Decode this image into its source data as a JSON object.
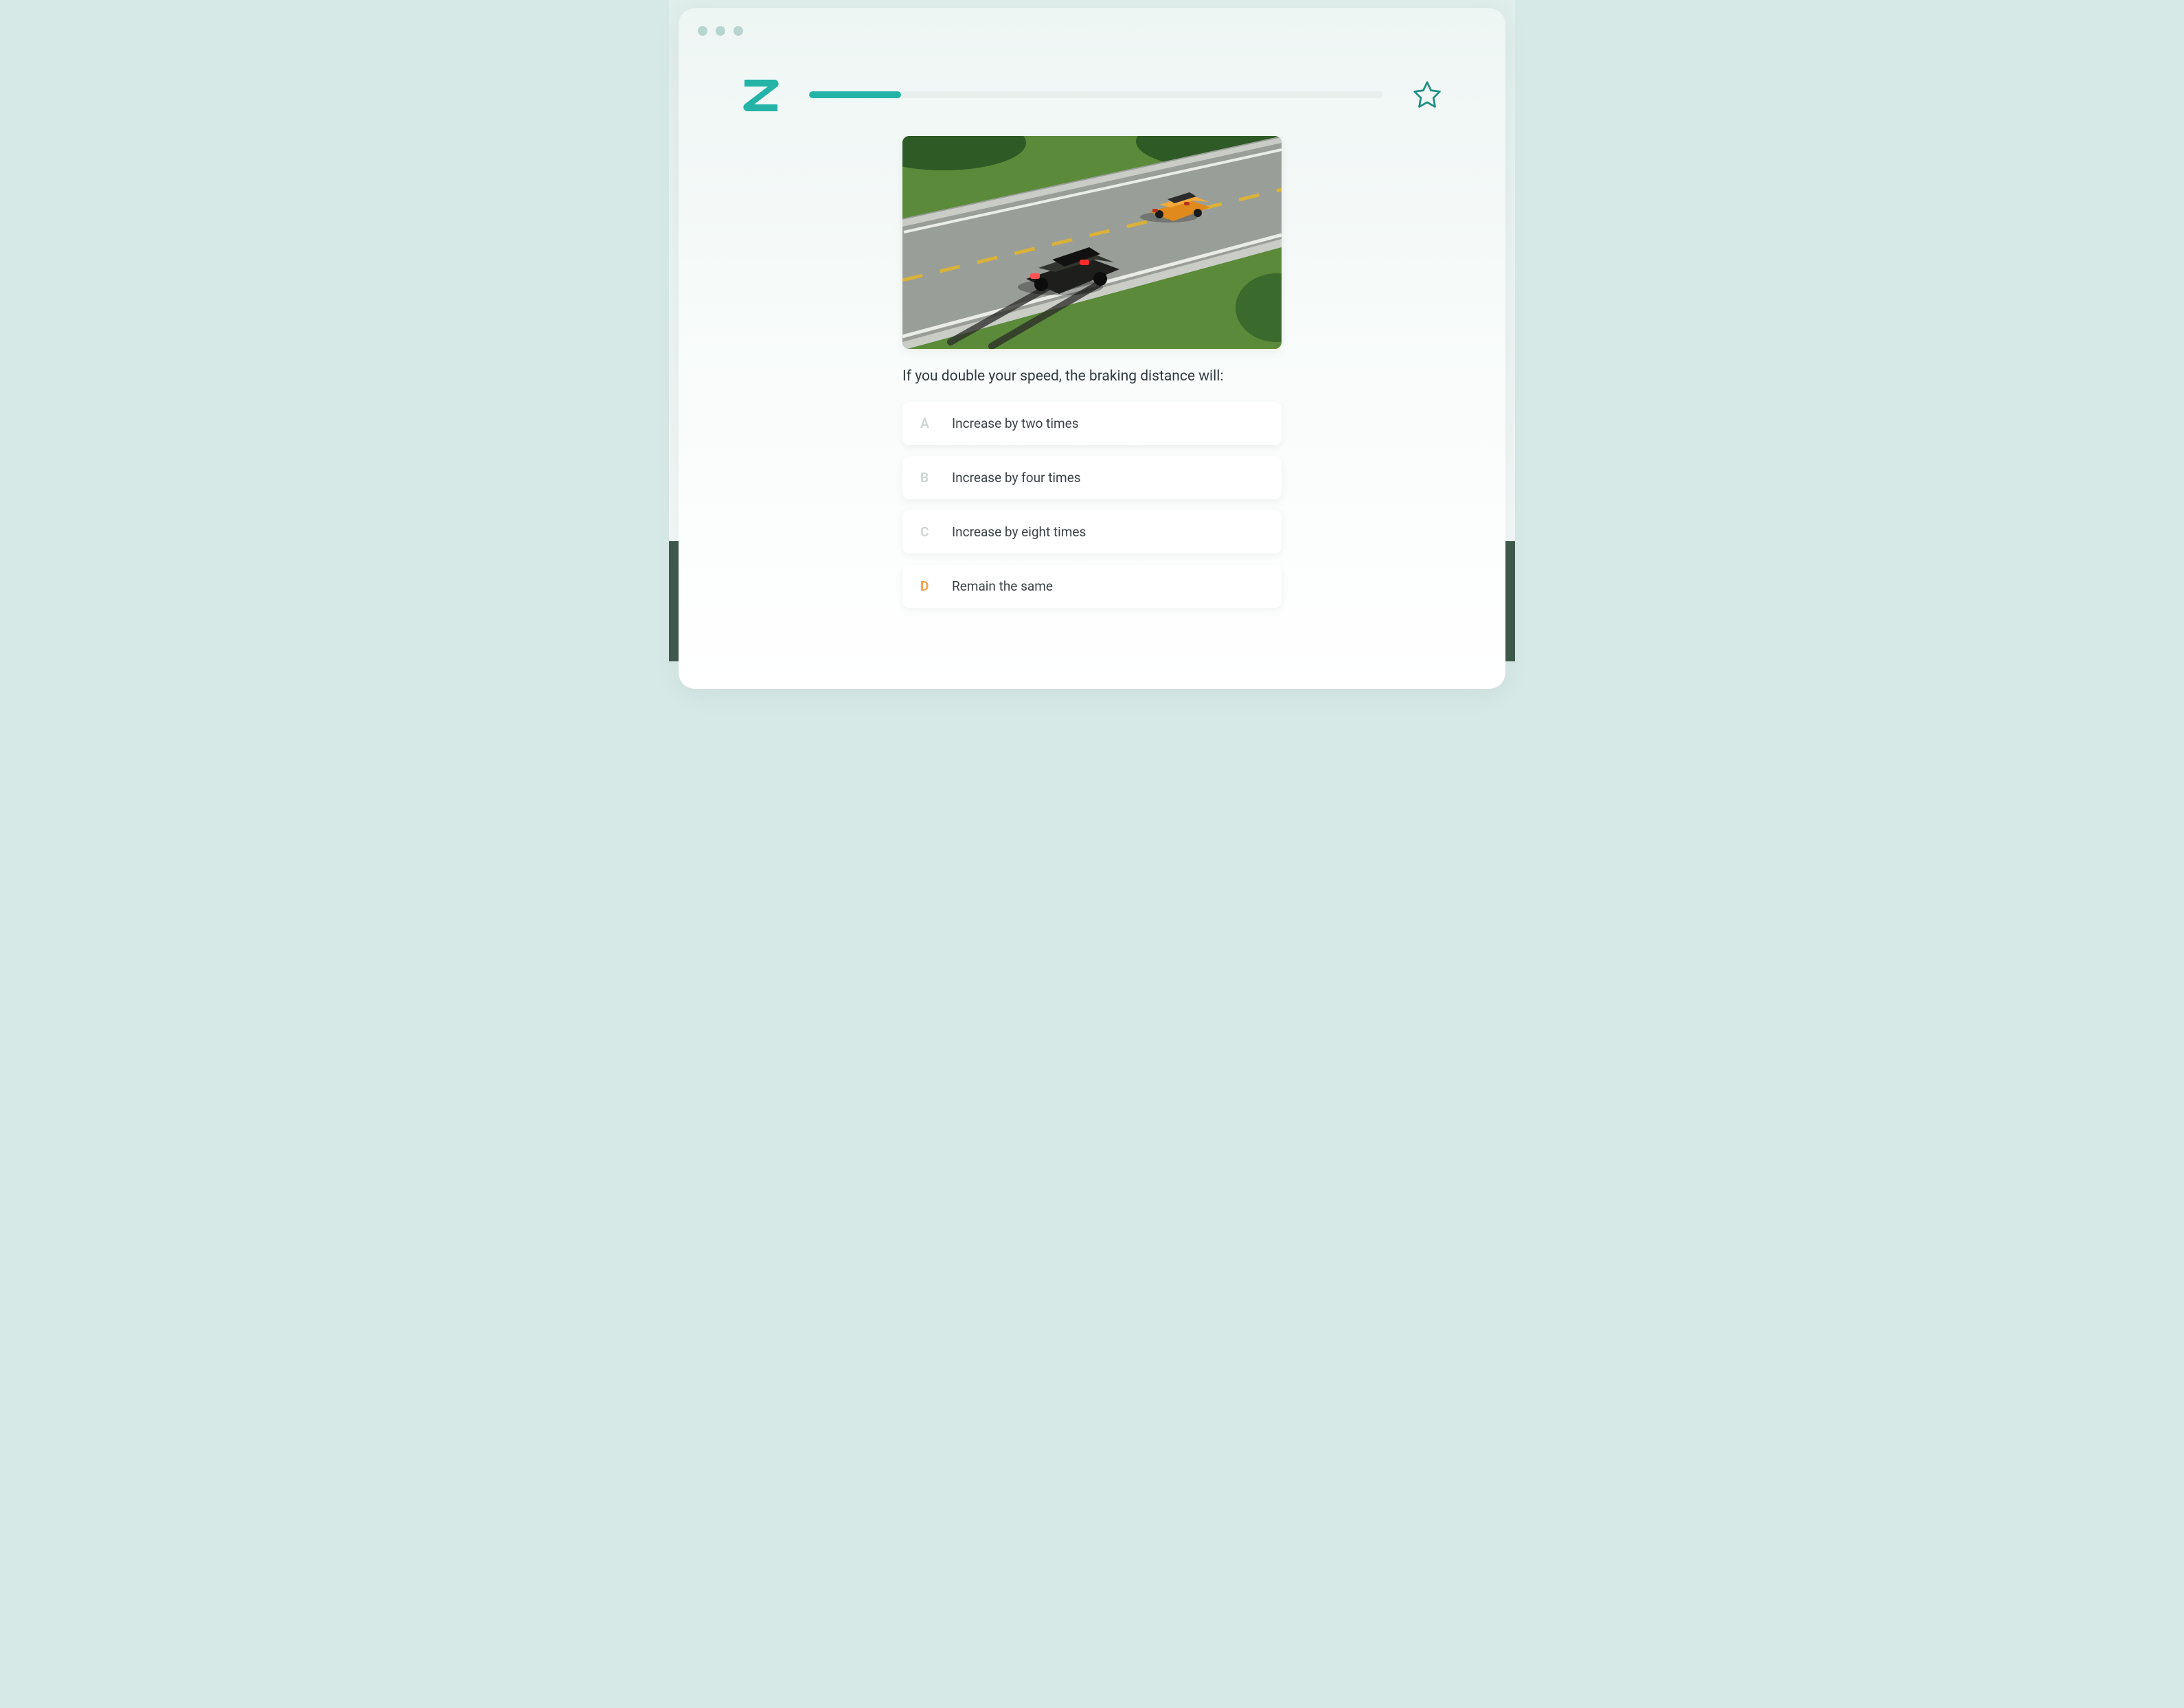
{
  "brand": {
    "logo_letter": "Z"
  },
  "progress": {
    "percent": 16
  },
  "question": {
    "image_alt": "Two cars on a two-lane road, the nearer dark car is braking leaving skid marks behind an orange car ahead",
    "text": "If you double your speed, the braking distance will:"
  },
  "answers": [
    {
      "letter": "A",
      "label": "Increase by two times",
      "highlight": false
    },
    {
      "letter": "B",
      "label": "Increase by four times",
      "highlight": false
    },
    {
      "letter": "C",
      "label": "Increase by eight times",
      "highlight": false
    },
    {
      "letter": "D",
      "label": "Remain the same",
      "highlight": true
    }
  ],
  "icons": {
    "star": "favorite-star"
  }
}
